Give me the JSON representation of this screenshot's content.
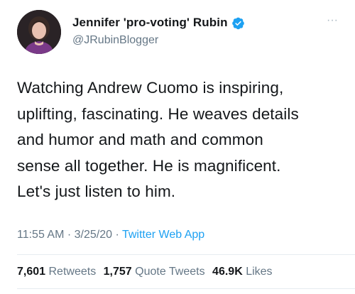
{
  "author": {
    "display_name": "Jennifer 'pro-voting' Rubin",
    "handle": "@JRubinBlogger",
    "verified_icon": "verified-badge-icon",
    "avatar_icon": "profile-photo"
  },
  "menu": {
    "more_icon": "more-options-icon",
    "more_glyph": "···"
  },
  "tweet": {
    "text": "Watching Andrew Cuomo is inspiring, uplifting, fascinating. He weaves details and humor and math and common sense all together. He is magnificent. Let's just listen to him.",
    "lines": [
      "Watching Andrew Cuomo is inspiring,",
      "uplifting, fascinating. He weaves details",
      "and humor and math and common",
      "sense all together. He is magnificent.",
      "Let's just listen to him."
    ],
    "time": "11:55 AM",
    "date": "3/25/20",
    "separator": "·",
    "source": "Twitter Web App"
  },
  "stats": {
    "retweets_count": "7,601",
    "retweets_label": "Retweets",
    "quotes_count": "1,757",
    "quotes_label": "Quote Tweets",
    "likes_count": "46.9K",
    "likes_label": "Likes"
  },
  "colors": {
    "text_primary": "#14171a",
    "text_secondary": "#657786",
    "accent": "#1da1f2",
    "divider": "#e6ecf0"
  }
}
